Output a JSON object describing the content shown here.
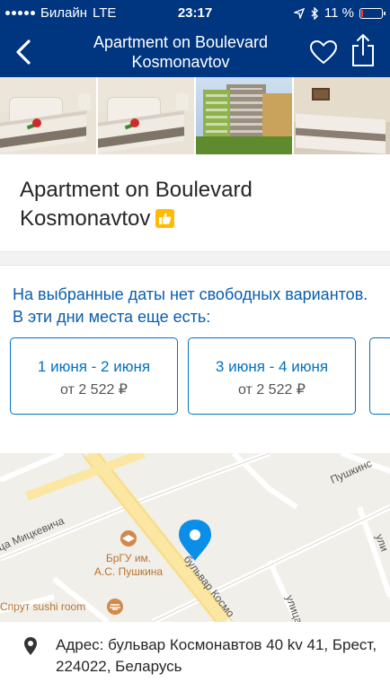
{
  "status_bar": {
    "carrier": "Билайн",
    "network": "LTE",
    "time": "23:17",
    "battery": "11 %",
    "battery_level": 0.11
  },
  "nav": {
    "title": "Apartment on Boulevard Kosmonavtov",
    "back_icon": "chevron-left-icon",
    "favorite_icon": "heart-outline-icon",
    "share_icon": "share-icon"
  },
  "hotel": {
    "title": "Apartment on Boulevard Kosmonavtov",
    "badge_icon": "thumbs-up-icon"
  },
  "availability": {
    "note": "На выбранные даты нет свободных вариантов. В эти дни места еще есть:",
    "options": [
      {
        "dates": "1 июня - 2 июня",
        "price": "от 2 522 ₽"
      },
      {
        "dates": "3 июня - 4 июня",
        "price": "от 2 522 ₽"
      }
    ]
  },
  "map": {
    "streets": {
      "mitskevich": "ца Мицкевича",
      "pushkinskaya": "Пушкинс",
      "kosmonavtov": "бульвар Космо",
      "ulitsa_right": "ули",
      "ulitsa_bottom": "улица"
    },
    "poi_university": "БрГУ им. А.С. Пушкина",
    "poi_restaurant": "Спрут sushi room",
    "colors": {
      "pin": "#0a8ee8",
      "poi": "#d2894a",
      "road_major": "#fbe6a2"
    }
  },
  "address": {
    "text": "Адрес: бульвар Космонавтов 40 kv 41, Брест, 224022, Беларусь",
    "icon": "location-pin-icon"
  },
  "colors": {
    "brand": "#003580",
    "link": "#0071c2",
    "badge": "#febb02"
  }
}
